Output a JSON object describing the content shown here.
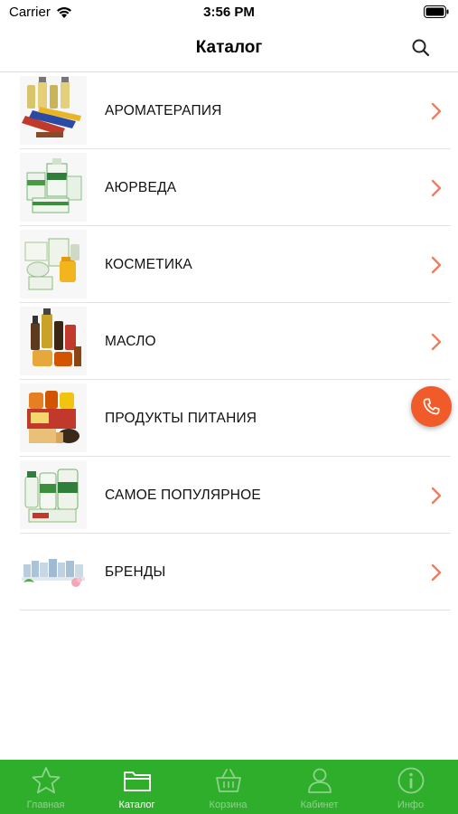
{
  "status_bar": {
    "carrier": "Carrier",
    "time": "3:56 PM"
  },
  "nav": {
    "title": "Каталог",
    "search_icon": "search-icon"
  },
  "catalog": {
    "items": [
      {
        "label": "АРОМАТЕРАПИЯ",
        "thumb": "aromatherapy-products-photo"
      },
      {
        "label": "АЮРВЕДА",
        "thumb": "ayurveda-products-photo"
      },
      {
        "label": "КОСМЕТИКА",
        "thumb": "cosmetics-products-photo"
      },
      {
        "label": "МАСЛО",
        "thumb": "oil-products-photo"
      },
      {
        "label": "ПРОДУКТЫ ПИТАНИЯ",
        "thumb": "food-products-photo"
      },
      {
        "label": "САМОЕ ПОПУЛЯРНОЕ",
        "thumb": "popular-products-photo"
      },
      {
        "label": "БРЕНДЫ",
        "thumb": "brands-products-photo"
      }
    ]
  },
  "call_button": {
    "icon": "phone-icon"
  },
  "tab_bar": {
    "tabs": [
      {
        "label": "Главная",
        "icon": "star-icon",
        "active": false
      },
      {
        "label": "Каталог",
        "icon": "folder-icon",
        "active": true
      },
      {
        "label": "Корзина",
        "icon": "basket-icon",
        "active": false
      },
      {
        "label": "Кабинет",
        "icon": "person-icon",
        "active": false
      },
      {
        "label": "Инфо",
        "icon": "info-icon",
        "active": false
      }
    ]
  },
  "colors": {
    "accent_orange": "#f15a29",
    "chevron": "#ef7b63",
    "tab_bar_green": "#2fae2c",
    "tab_inactive": "#8fd28c",
    "tab_active": "#ffffff"
  }
}
